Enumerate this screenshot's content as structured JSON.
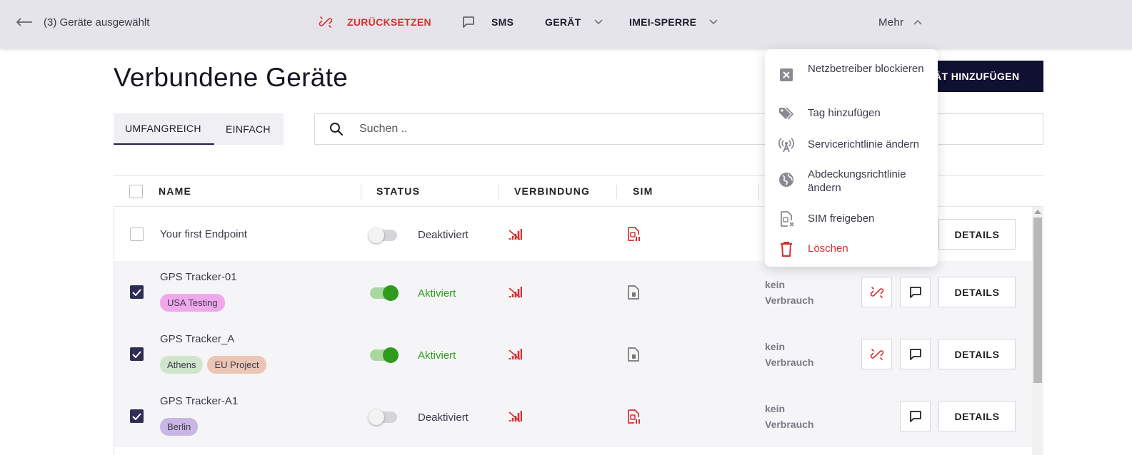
{
  "topbar": {
    "selected_count": "(3) Geräte ausgewählt",
    "reset_label": "ZURÜCKSETZEN",
    "sms_label": "SMS",
    "device_label": "GERÄT",
    "imei_label": "IMEI-SPERRE",
    "more_label": "Mehr"
  },
  "page": {
    "title": "Verbundene Geräte",
    "add_button": "ÄT HINZUFÜGEN"
  },
  "tabs": [
    {
      "label": "UMFANGREICH",
      "active": true
    },
    {
      "label": "EINFACH",
      "active": false
    }
  ],
  "search": {
    "placeholder": "Suchen .."
  },
  "table": {
    "headers": {
      "name": "NAME",
      "status": "STATUS",
      "connection": "VERBINDUNG",
      "sim": "SIM"
    },
    "rows": [
      {
        "name": "Your first Endpoint",
        "checked": false,
        "tags": [],
        "status": "Deaktiviert",
        "active": false,
        "usage": "",
        "details": "DETAILS"
      },
      {
        "name": "GPS Tracker-01",
        "checked": true,
        "tags": [
          "USA Testing"
        ],
        "status": "Aktiviert",
        "active": true,
        "usage1": "kein",
        "usage2": "Verbrauch",
        "details": "DETAILS"
      },
      {
        "name": "GPS Tracker_A",
        "checked": true,
        "tags": [
          "Athens",
          "EU Project"
        ],
        "status": "Aktiviert",
        "active": true,
        "usage1": "kein",
        "usage2": "Verbrauch",
        "details": "DETAILS"
      },
      {
        "name": "GPS Tracker-A1",
        "checked": true,
        "tags": [
          "Berlin"
        ],
        "status": "Deaktiviert",
        "active": false,
        "usage1": "kein",
        "usage2": "Verbrauch",
        "details": "DETAILS"
      }
    ]
  },
  "menu": {
    "items": [
      {
        "label": "Netzbetreiber blockieren",
        "icon": "block-operator-icon"
      },
      {
        "label": "Tag hinzufügen",
        "icon": "tag-icon"
      },
      {
        "label": "Servicerichtlinie ändern",
        "icon": "antenna-icon"
      },
      {
        "label": "Abdeckungsrichtlinie ändern",
        "icon": "globe-icon"
      },
      {
        "label": "SIM freigeben",
        "icon": "sim-release-icon"
      },
      {
        "label": "Löschen",
        "icon": "trash-icon"
      }
    ]
  },
  "colors": {
    "accent_dark": "#101030",
    "danger": "#d23232",
    "active_green": "#2e9b1c",
    "tag_usa": "#f0a8ec",
    "tag_athens": "#cfe6cd",
    "tag_eu": "#ecc5b4",
    "tag_berlin": "#c9b6e4"
  }
}
